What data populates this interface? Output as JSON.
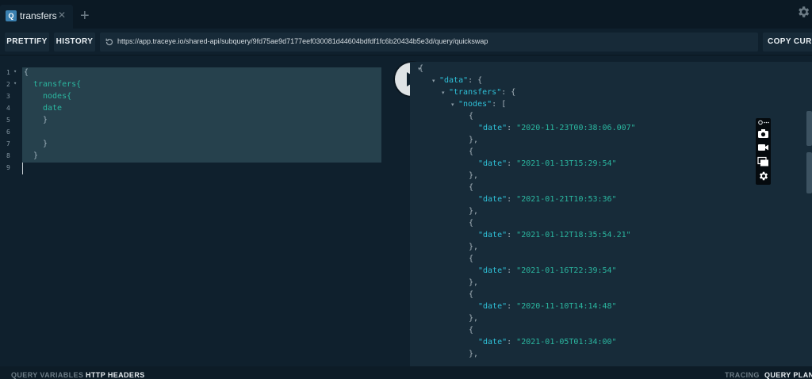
{
  "tab": {
    "icon_letter": "Q",
    "label": "transfers",
    "close_glyph": "✕"
  },
  "add_tab_glyph": "+",
  "toolbar": {
    "prettify_label": "PRETTIFY",
    "history_label": "HISTORY",
    "url": "https://app.traceye.io/shared-api/subquery/9fd75ae9d7177eef030081d44604bdfdf1fc6b20434b5e3d/query/quickswap",
    "copy_curl_label": "COPY CURL"
  },
  "editor": {
    "line_numbers": [
      "1",
      "2",
      "3",
      "4",
      "5",
      "6",
      "7",
      "8",
      "9"
    ],
    "fold_marker": "▾",
    "lines": [
      {
        "text": "{",
        "indent": 0,
        "kind": "punct"
      },
      {
        "text": "transfers{",
        "indent": 1,
        "kind": "field"
      },
      {
        "text": "nodes{",
        "indent": 2,
        "kind": "field"
      },
      {
        "text": "date",
        "indent": 2,
        "kind": "field"
      },
      {
        "text": "}",
        "indent": 2,
        "kind": "punct"
      },
      {
        "text": "",
        "indent": 0,
        "kind": "punct"
      },
      {
        "text": "}",
        "indent": 2,
        "kind": "punct"
      },
      {
        "text": "}",
        "indent": 1,
        "kind": "punct"
      },
      {
        "text": "",
        "indent": 0,
        "kind": "punct"
      }
    ]
  },
  "result": {
    "open_brace": "{",
    "data_key": "\"data\"",
    "transfers_key": "\"transfers\"",
    "nodes_key": "\"nodes\"",
    "object_open": "{",
    "object_close": "},",
    "array_open": "[",
    "colon_brace": ": {",
    "colon_bracket": ": [",
    "date_key": "\"date\"",
    "dates": [
      "\"2020-11-23T00:38:06.007\"",
      "\"2021-01-13T15:29:54\"",
      "\"2021-01-21T10:53:36\"",
      "\"2021-01-12T18:35:54.21\"",
      "\"2021-01-16T22:39:54\"",
      "\"2020-11-10T14:14:48\"",
      "\"2021-01-05T01:34:00\""
    ]
  },
  "footer": {
    "query_variables": "QUERY VARIABLES",
    "http_headers": "HTTP HEADERS",
    "tracing": "TRACING",
    "query_plan": "QUERY PLAN"
  }
}
